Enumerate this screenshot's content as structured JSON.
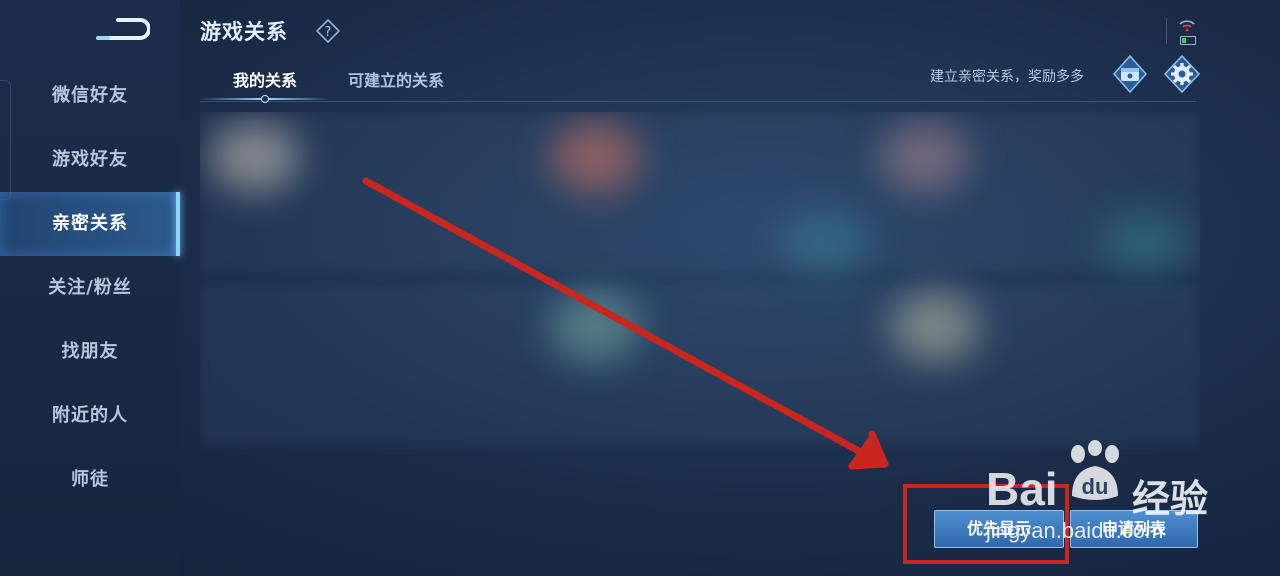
{
  "header": {
    "title": "游戏关系",
    "promo_text": "建立亲密关系，奖励多多"
  },
  "sidebar": {
    "items": [
      {
        "label": "微信好友"
      },
      {
        "label": "游戏好友"
      },
      {
        "label": "亲密关系",
        "active": true
      },
      {
        "label": "关注/粉丝"
      },
      {
        "label": "找朋友"
      },
      {
        "label": "附近的人"
      },
      {
        "label": "师徒"
      }
    ]
  },
  "tabs": [
    {
      "label": "我的关系",
      "active": true
    },
    {
      "label": "可建立的关系",
      "active": false
    }
  ],
  "buttons": {
    "priority": "优先显示",
    "apply_list": "申请列表"
  },
  "watermark": {
    "brand": "Bai",
    "brand_tail": "du",
    "cn": "经验",
    "url": "jingyan.baidu.com"
  },
  "colors": {
    "accent": "#8fd3ff",
    "annotation_red": "#c8261e",
    "button_blue": "#3f7cc0"
  },
  "icons": [
    "back-icon",
    "help-icon",
    "chest-icon",
    "gear-icon",
    "wifi-icon",
    "battery-icon",
    "baidu-paw-icon"
  ]
}
